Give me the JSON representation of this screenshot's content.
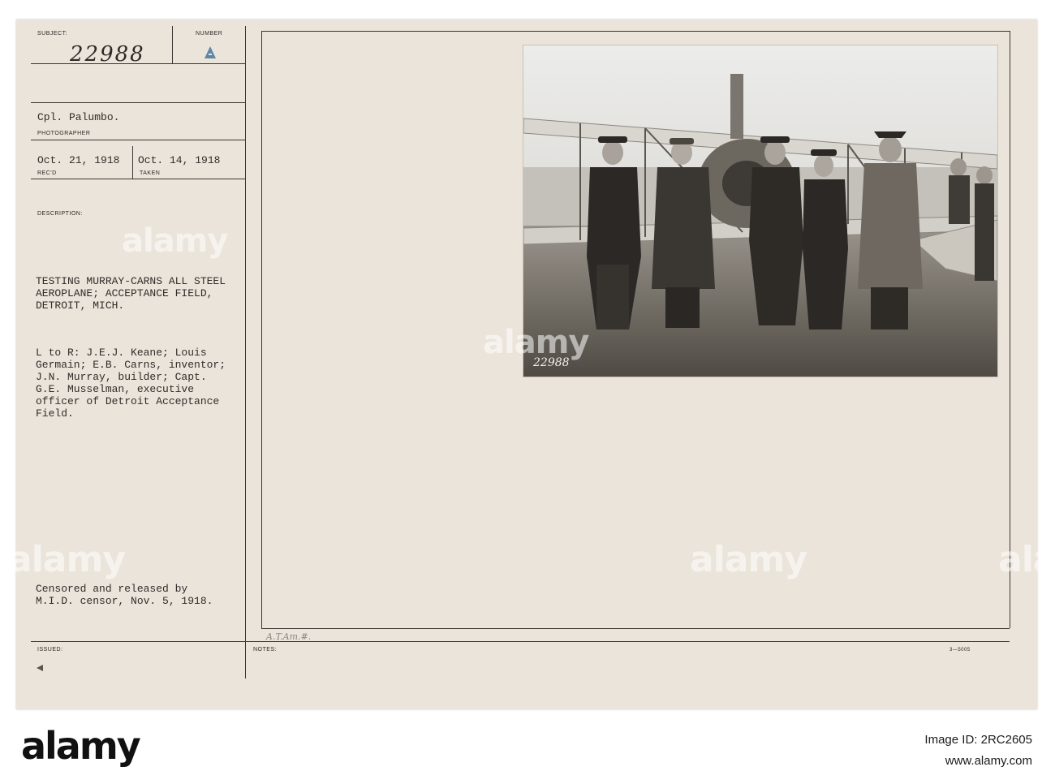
{
  "card": {
    "subject_label": "SUBJECT:",
    "number_label": "NUMBER",
    "subject_number": "22988",
    "photographer_name": "Cpl. Palumbo.",
    "photographer_label": "PHOTOGRAPHER",
    "received_date": "Oct. 21, 1918",
    "received_label": "REC'D",
    "taken_date": "Oct. 14, 1918",
    "taken_label": "TAKEN",
    "description_label": "DESCRIPTION:",
    "description": "TESTING MURRAY-CARNS ALL STEEL\nAEROPLANE; ACCEPTANCE FIELD,\nDETROIT, MICH.",
    "caption": "L to R: J.E.J. Keane; Louis\nGermain; E.B. Carns, inventor;\nJ.N. Murray, builder; Capt.\nG.E. Musselman, executive\nofficer of Detroit Acceptance\nField.",
    "censor_note": "Censored and released by\nM.I.D. censor, Nov. 5, 1918.",
    "issued_label": "ISSUED:",
    "notes_label": "NOTES:",
    "pencil_note": "A.T.Am.#.",
    "form_code": "3—5005",
    "photo_number": "22988"
  },
  "watermark": {
    "text": "alamy"
  },
  "footer": {
    "logo": "alamy",
    "image_id_label": "Image ID: 2RC2605",
    "site": "www.alamy.com"
  }
}
